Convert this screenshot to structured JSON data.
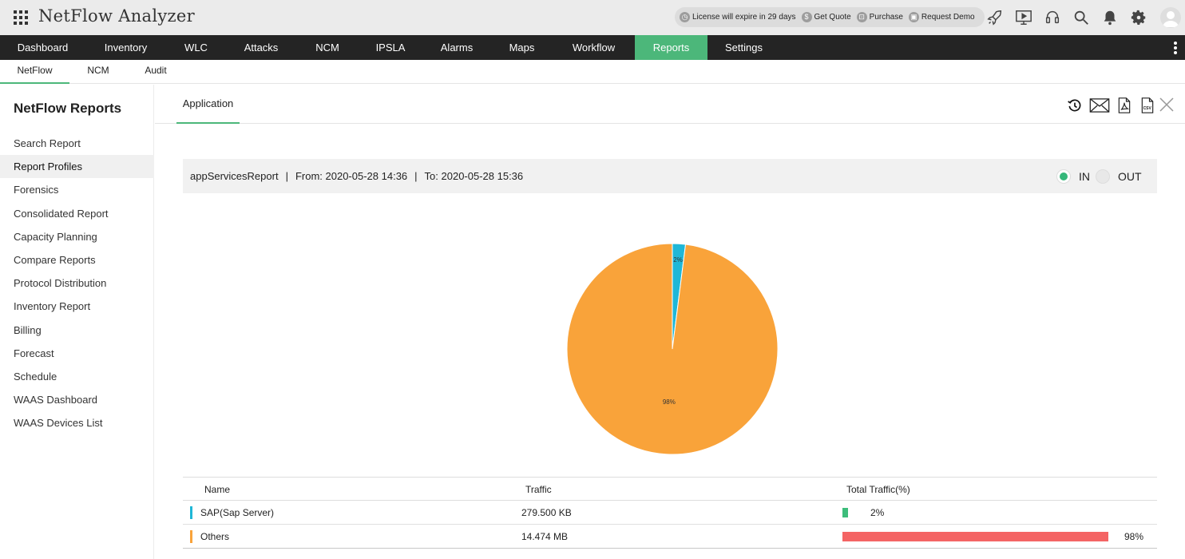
{
  "app": {
    "title": "NetFlow Analyzer"
  },
  "license": {
    "expiry": "License will expire in 29 days",
    "get_quote": "Get Quote",
    "purchase": "Purchase",
    "request_demo": "Request Demo"
  },
  "top_icons": [
    "rocket-icon",
    "presentation-icon",
    "headset-icon",
    "search-icon",
    "bell-icon",
    "gear-icon"
  ],
  "nav": {
    "items": [
      {
        "label": "Dashboard",
        "active": false
      },
      {
        "label": "Inventory",
        "active": false
      },
      {
        "label": "WLC",
        "active": false
      },
      {
        "label": "Attacks",
        "active": false
      },
      {
        "label": "NCM",
        "active": false
      },
      {
        "label": "IPSLA",
        "active": false
      },
      {
        "label": "Alarms",
        "active": false
      },
      {
        "label": "Maps",
        "active": false
      },
      {
        "label": "Workflow",
        "active": false
      },
      {
        "label": "Reports",
        "active": true
      },
      {
        "label": "Settings",
        "active": false
      }
    ]
  },
  "subnav": {
    "items": [
      {
        "label": "NetFlow",
        "active": true
      },
      {
        "label": "NCM",
        "active": false
      },
      {
        "label": "Audit",
        "active": false
      }
    ]
  },
  "sidebar": {
    "title": "NetFlow Reports",
    "items": [
      {
        "label": "Search Report",
        "active": false
      },
      {
        "label": "Report Profiles",
        "active": true
      },
      {
        "label": "Forensics",
        "active": false
      },
      {
        "label": "Consolidated Report",
        "active": false
      },
      {
        "label": "Capacity Planning",
        "active": false
      },
      {
        "label": "Compare Reports",
        "active": false
      },
      {
        "label": "Protocol Distribution",
        "active": false
      },
      {
        "label": "Inventory Report",
        "active": false
      },
      {
        "label": "Billing",
        "active": false
      },
      {
        "label": "Forecast",
        "active": false
      },
      {
        "label": "Schedule",
        "active": false
      },
      {
        "label": "WAAS Dashboard",
        "active": false
      },
      {
        "label": "WAAS Devices List",
        "active": false
      }
    ]
  },
  "content": {
    "tab": "Application",
    "report_name": "appServicesReport",
    "separator": "|",
    "from": "From: 2020-05-28 14:36",
    "to": "To: 2020-05-28 15:36",
    "direction": {
      "in_label": "IN",
      "out_label": "OUT",
      "selected": "IN"
    }
  },
  "chart_data": {
    "type": "pie",
    "categories": [
      "SAP(Sap Server)",
      "Others"
    ],
    "values": [
      2,
      98
    ],
    "labels": [
      "2%",
      "98%"
    ],
    "colors": [
      "#1fb7d7",
      "#f9a33a"
    ]
  },
  "table": {
    "headers": {
      "name": "Name",
      "traffic": "Traffic",
      "total": "Total Traffic(%)"
    },
    "rows": [
      {
        "name": "SAP(Sap Server)",
        "traffic": "279.500 KB",
        "percent_label": "2%",
        "percent": 2,
        "marker_color": "#1fb7d7",
        "bar_color": "#3dbd7b"
      },
      {
        "name": "Others",
        "traffic": "14.474 MB",
        "percent_label": "98%",
        "percent": 98,
        "marker_color": "#f9a33a",
        "bar_color": "#f46464"
      }
    ]
  }
}
